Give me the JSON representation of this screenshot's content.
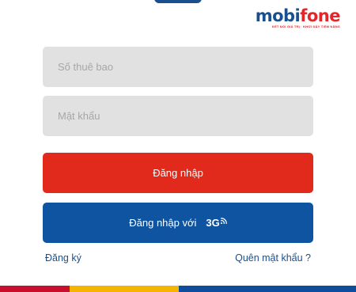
{
  "logo": {
    "word_part1": "mobi",
    "word_part2": "fone",
    "tagline": "KẾT NỐI GIÁ TRỊ · KHƠI DẬY TIỀM NĂNG"
  },
  "form": {
    "subscriber_placeholder": "Số thuê bao",
    "password_placeholder": "Mật khẩu",
    "login_label": "Đăng nhập",
    "login_3g_label": "Đăng nhập với",
    "login_3g_tag": "3G"
  },
  "links": {
    "register": "Đăng ký",
    "forgot_password": "Quên mật khẩu ?"
  },
  "colors": {
    "brand_blue": "#1a4f8f",
    "brand_red": "#e3262a",
    "button_red": "#e12a1c",
    "button_blue": "#0f54a0",
    "field_bg": "#e1e1e1",
    "footer_red": "#c8102e",
    "footer_yellow": "#f5b400",
    "footer_blue": "#0f4c9c"
  }
}
